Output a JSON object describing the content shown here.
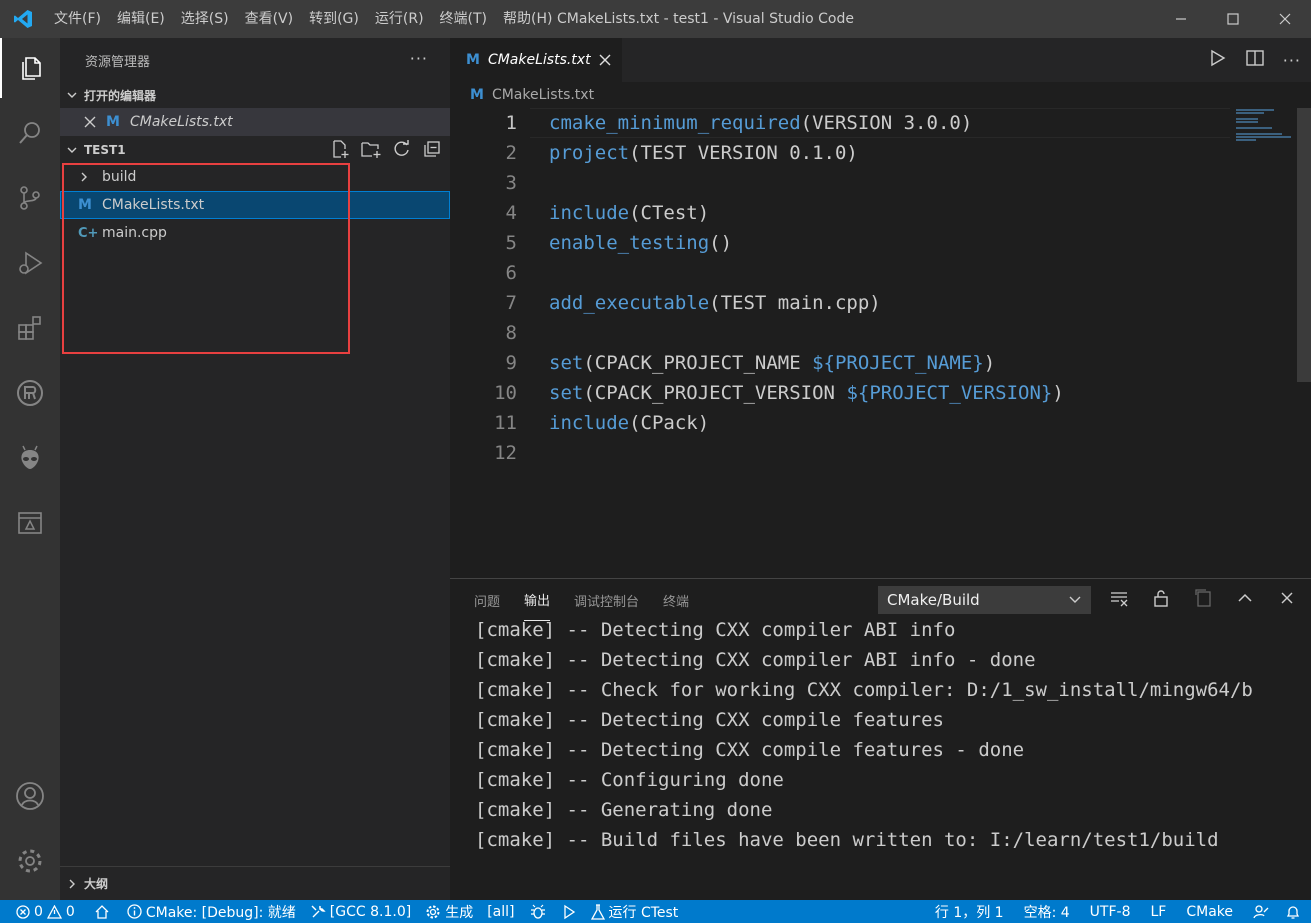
{
  "window": {
    "title": "CMakeLists.txt - test1 - Visual Studio Code",
    "menu": [
      "文件(F)",
      "编辑(E)",
      "选择(S)",
      "查看(V)",
      "转到(G)",
      "运行(R)",
      "终端(T)",
      "帮助(H)"
    ]
  },
  "activity_bar": {
    "icons": [
      "explorer-icon",
      "search-icon",
      "source-control-icon",
      "run-debug-icon",
      "extensions-icon",
      "platformio-icon",
      "alien-icon",
      "remote-explorer-icon",
      "account-icon",
      "settings-gear-icon"
    ]
  },
  "sidebar": {
    "header": "资源管理器",
    "open_editors": {
      "title": "打开的编辑器",
      "items": [
        {
          "name": "CMakeLists.txt"
        }
      ]
    },
    "folder": {
      "title": "TEST1",
      "items": [
        {
          "name": "build",
          "type": "folder"
        },
        {
          "name": "CMakeLists.txt",
          "type": "cmake"
        },
        {
          "name": "main.cpp",
          "type": "cpp"
        }
      ]
    },
    "outline_title": "大纲"
  },
  "editor": {
    "tab_label": "CMakeLists.txt",
    "breadcrumb": "CMakeLists.txt",
    "lines": [
      {
        "n": "1",
        "fn": "cmake_minimum_required",
        "args": "(VERSION 3.0.0)"
      },
      {
        "n": "2",
        "fn": "project",
        "args": "(TEST VERSION 0.1.0)"
      },
      {
        "n": "3",
        "fn": "",
        "args": ""
      },
      {
        "n": "4",
        "fn": "include",
        "args": "(CTest)"
      },
      {
        "n": "5",
        "fn": "enable_testing",
        "args": "()"
      },
      {
        "n": "6",
        "fn": "",
        "args": ""
      },
      {
        "n": "7",
        "fn": "add_executable",
        "args": "(TEST main.cpp)"
      },
      {
        "n": "8",
        "fn": "",
        "args": ""
      },
      {
        "n": "9",
        "fn": "set",
        "args": "(CPACK_PROJECT_NAME ",
        "var": "${PROJECT_NAME}",
        "tail": ")"
      },
      {
        "n": "10",
        "fn": "set",
        "args": "(CPACK_PROJECT_VERSION ",
        "var": "${PROJECT_VERSION}",
        "tail": ")"
      },
      {
        "n": "11",
        "fn": "include",
        "args": "(CPack)"
      },
      {
        "n": "12",
        "fn": "",
        "args": ""
      }
    ]
  },
  "panel": {
    "tabs": [
      "问题",
      "输出",
      "调试控制台",
      "终端"
    ],
    "active_tab": "输出",
    "channel": "CMake/Build",
    "output_lines": [
      "[cmake] -- Detecting CXX compiler ABI info",
      "[cmake] -- Detecting CXX compiler ABI info - done",
      "[cmake] -- Check for working CXX compiler: D:/1_sw_install/mingw64/b",
      "[cmake] -- Detecting CXX compile features",
      "[cmake] -- Detecting CXX compile features - done",
      "[cmake] -- Configuring done",
      "[cmake] -- Generating done",
      "[cmake] -- Build files have been written to: I:/learn/test1/build"
    ]
  },
  "status_bar": {
    "errors": "0",
    "warnings": "0",
    "cmake_status": "CMake: [Debug]: 就绪",
    "kit": "[GCC 8.1.0]",
    "build": "生成",
    "target": "[all]",
    "ctest": "运行 CTest",
    "position": "行 1，列 1",
    "indent": "空格: 4",
    "encoding": "UTF-8",
    "eol": "LF",
    "language": "CMake"
  },
  "colors": {
    "accent": "#007acc",
    "keyword": "#569cd6",
    "highlight_box": "#e84040"
  }
}
